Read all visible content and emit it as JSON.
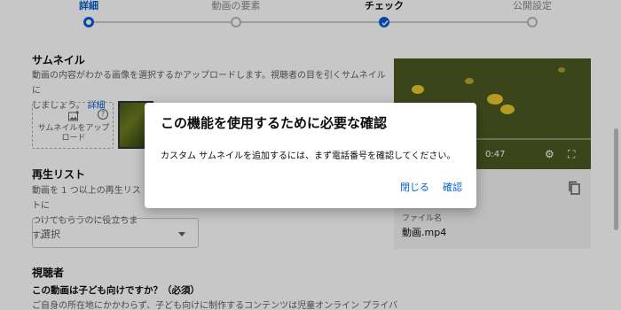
{
  "stepper": {
    "steps": [
      {
        "label": "詳細",
        "state": "active"
      },
      {
        "label": "動画の要素",
        "state": "pending"
      },
      {
        "label": "チェック",
        "state": "done"
      },
      {
        "label": "公開設定",
        "state": "pending"
      }
    ]
  },
  "thumbnail": {
    "title": "サムネイル",
    "desc_line1": "動画の内容がわかる画像を選択するかアップロードします。視聴者の目を引くサムネイルに",
    "desc_line2": "しましょう。",
    "details_link": "詳細",
    "upload_label_1": "サムネイルをアップ",
    "upload_label_2": "ロード"
  },
  "playlist": {
    "title": "再生リスト",
    "desc_line1": "動画を 1 つ以上の再生リストに",
    "desc_line2": "つけてもらうのに役立ちます。",
    "select_value": "選択"
  },
  "audience": {
    "title": "視聴者",
    "question": "この動画は子ども向けですか？（必須）",
    "desc": "ご自身の所在地にかかわらず、子ども向けに制作するコンテンツは児童オンライン プライバ"
  },
  "preview": {
    "time": "0:47",
    "file_label": "ファイル名",
    "file_name": "動画.mp4"
  },
  "dialog": {
    "title": "この機能を使用するために必要な確認",
    "message": "カスタム サムネイルを追加するには、まず電話番号を確認してください。",
    "close_label": "閉じる",
    "confirm_label": "確認"
  },
  "colors": {
    "accent": "#065fd4",
    "overlay": "rgba(0,0,0,0.22)"
  }
}
